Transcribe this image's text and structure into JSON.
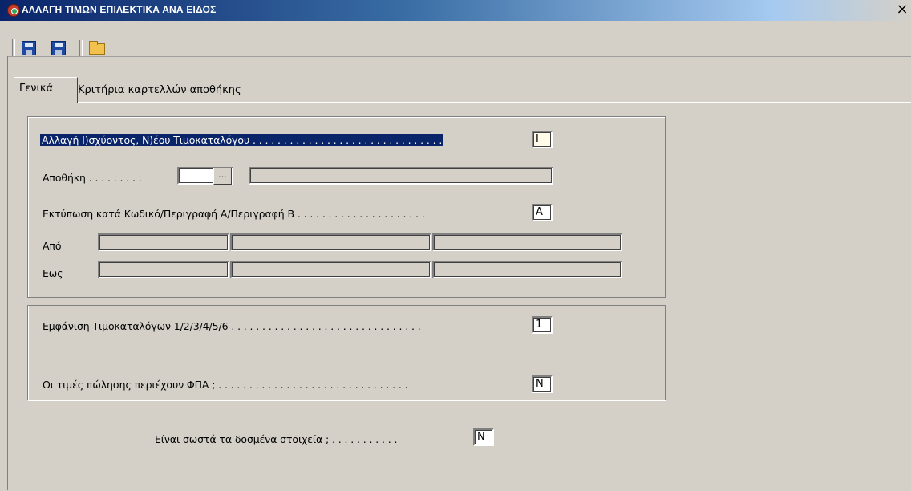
{
  "window": {
    "title": "ΑΛΛΑΓΗ ΤΙΜΩΝ ΕΠΙΛΕΚΤΙΚΑ ΑΝΑ ΕΙΔΟΣ",
    "close_label": "×"
  },
  "toolbar": {
    "buttons": [
      {
        "name": "save-icon"
      },
      {
        "name": "save-as-icon"
      },
      {
        "name": "open-folder-icon"
      }
    ]
  },
  "tabs": [
    {
      "label": "Γενικά",
      "active": true
    },
    {
      "label": "Κριτήρια καρτελλών αποθήκης",
      "active": false
    }
  ],
  "general": {
    "change_pricelist_label": "Αλλαγή Ι)σχύοντος, Ν)έου Τιμοκαταλόγου . . . . . . . . . . . . . . . . . . . . . . . . . . . . . . .",
    "change_pricelist_value": "I",
    "warehouse_label": "Αποθήκη . . . . . . . . .",
    "warehouse_code": "",
    "warehouse_lookup_label": "...",
    "warehouse_description": "",
    "print_by_label": "Εκτύπωση κατά Κωδικό/Περιγραφή Α/Περιγραφή Β . . . . . . . . . . . . . . . . . . . . .",
    "print_by_value": "A",
    "from_label": "Από",
    "to_label": "Εως",
    "from_values": [
      "",
      "",
      ""
    ],
    "to_values": [
      "",
      "",
      ""
    ]
  },
  "display": {
    "show_pricelists_label": "Εμφάνιση Τιμοκαταλόγων 1/2/3/4/5/6 . . . . . . . . . . . . . . . . . . . . . . . . . . . . . . .",
    "show_pricelists_value": "1",
    "prices_include_vat_label": "Οι τιμές πώλησης περιέχουν ΦΠΑ ; . . . . . . . . . . . . . . . . . . . . . . . . . . . . . . .",
    "prices_include_vat_value": "N"
  },
  "confirm": {
    "label": "Είναι σωστά τα δοσμένα στοιχεία ; . . . . . . . . . . .",
    "value": "N"
  }
}
